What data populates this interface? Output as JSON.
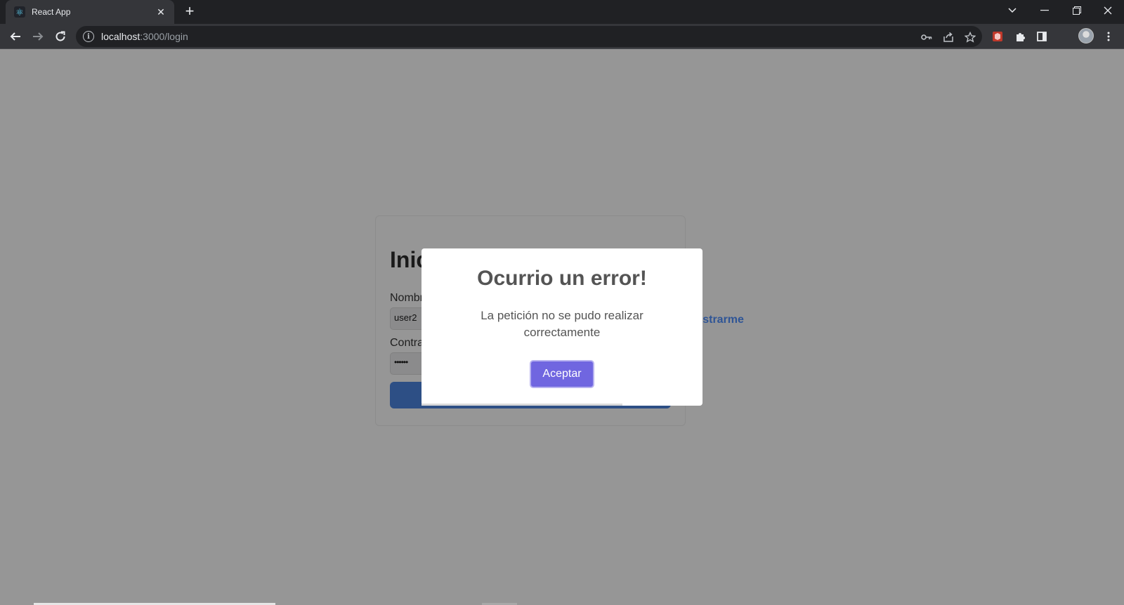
{
  "browser": {
    "tab_title": "React App",
    "tab_close": "✕",
    "new_tab": "+",
    "url_host": "localhost",
    "url_rest": ":3000/login"
  },
  "login": {
    "heading_partial": "Inic",
    "username_label_partial": "Nombr",
    "username_value": "user2",
    "password_label_partial": "Contra",
    "password_value": "••••••",
    "register_partial": "gistrarme"
  },
  "modal": {
    "title": "Ocurrio un error!",
    "message": "La petición no se pudo realizar correctamente",
    "confirm_label": "Aceptar"
  },
  "colors": {
    "confirm_button": "#7066e0",
    "overlay_bg": "#969696",
    "submit_button": "#2d4f85"
  }
}
